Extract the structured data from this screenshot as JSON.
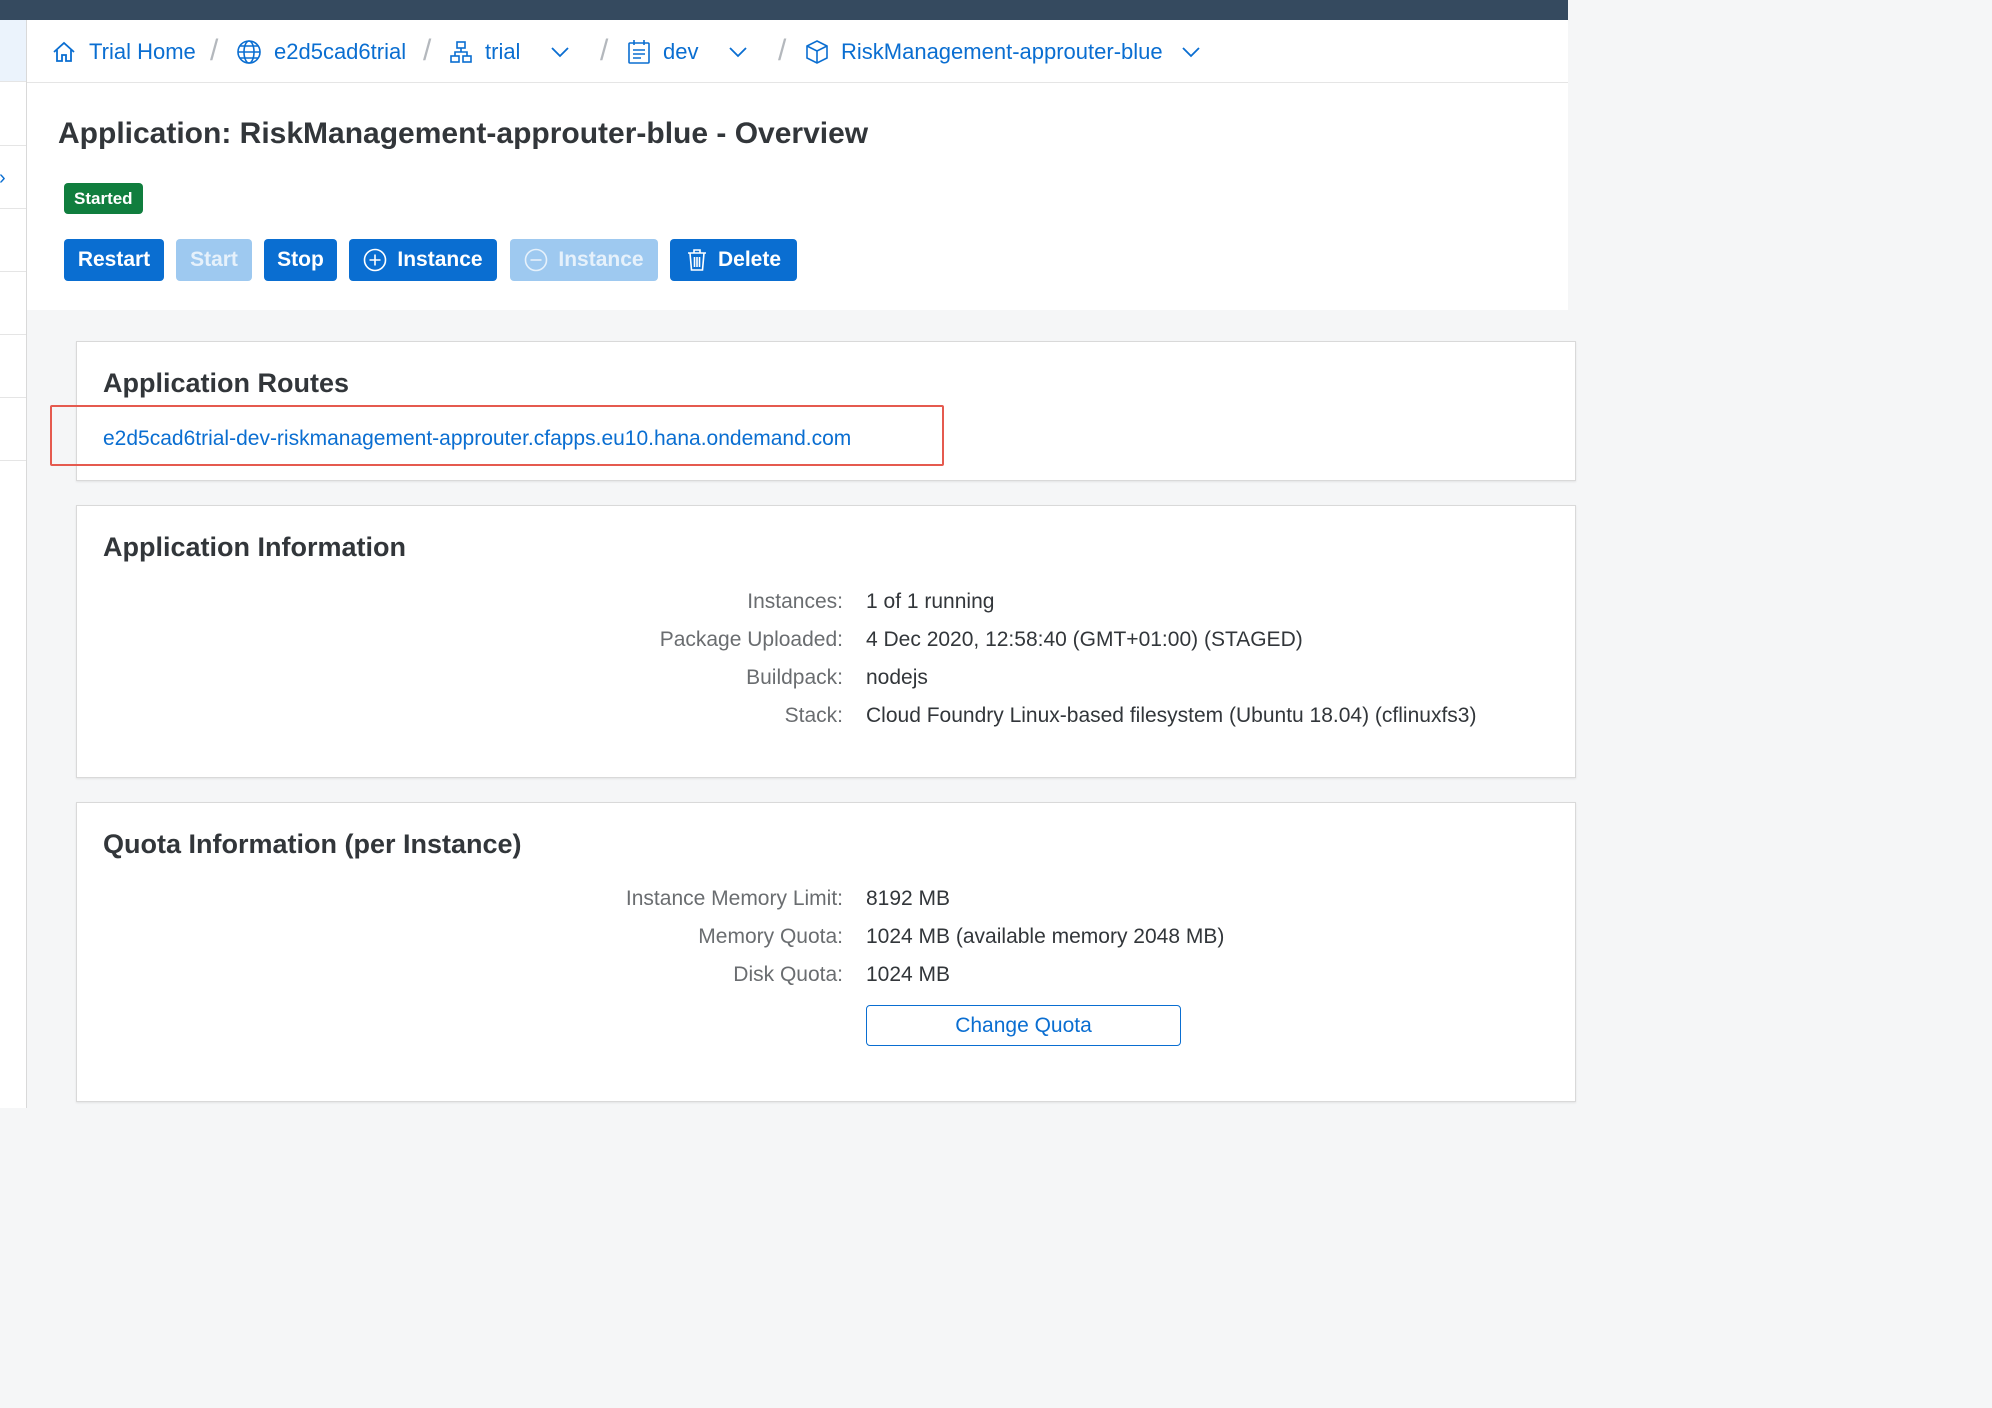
{
  "breadcrumb": [
    {
      "label": "Trial Home",
      "icon": "home-icon"
    },
    {
      "label": "e2d5cad6trial",
      "icon": "globe-icon"
    },
    {
      "label": "trial",
      "icon": "hierarchy-icon",
      "dropdown": true
    },
    {
      "label": "dev",
      "icon": "calendar-icon",
      "dropdown": true
    },
    {
      "label": "RiskManagement-approuter-blue",
      "icon": "cube-icon",
      "dropdown": true
    }
  ],
  "page": {
    "title": "Application: RiskManagement-approuter-blue - Overview",
    "status": "Started"
  },
  "actions": {
    "restart": "Restart",
    "start": "Start",
    "stop": "Stop",
    "add_instance": "Instance",
    "remove_instance": "Instance",
    "delete": "Delete"
  },
  "routes": {
    "title": "Application Routes",
    "items": [
      "e2d5cad6trial-dev-riskmanagement-approuter.cfapps.eu10.hana.ondemand.com"
    ]
  },
  "app_info": {
    "title": "Application Information",
    "rows": [
      {
        "label": "Instances:",
        "value": "1 of 1 running"
      },
      {
        "label": "Package Uploaded:",
        "value": "4 Dec 2020, 12:58:40 (GMT+01:00) (STAGED)"
      },
      {
        "label": "Buildpack:",
        "value": "nodejs"
      },
      {
        "label": "Stack:",
        "value": "Cloud Foundry Linux-based filesystem (Ubuntu 18.04) (cflinuxfs3)"
      }
    ]
  },
  "quota_info": {
    "title": "Quota Information (per Instance)",
    "rows": [
      {
        "label": "Instance Memory Limit:",
        "value": "8192 MB"
      },
      {
        "label": "Memory Quota:",
        "value": "1024 MB (available memory 2048 MB)"
      },
      {
        "label": "Disk Quota:",
        "value": "1024 MB"
      }
    ],
    "button": "Change Quota"
  },
  "colors": {
    "shell": "#354a5f",
    "accent": "#0a6ed1",
    "success": "#107e3e",
    "highlight": "#e55a4f"
  }
}
